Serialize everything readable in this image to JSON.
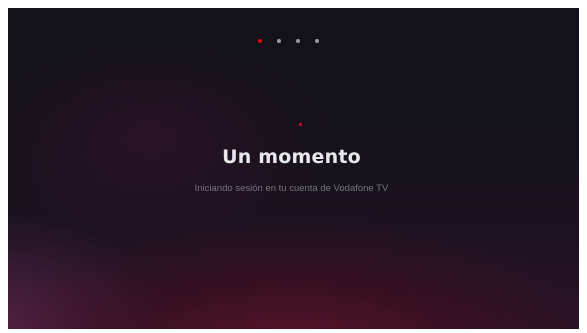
{
  "screen": {
    "title": "Un momento",
    "subtitle": "Iniciando sesión en tu cuenta de Vodafone TV"
  },
  "pager": {
    "total": 4,
    "active_index": 0
  },
  "colors": {
    "accent": "#e60000",
    "title_text": "#e9e8ec",
    "subtitle_text": "#77737d",
    "inactive_dot": "#9b9aa2"
  },
  "icons": {
    "loading": "loading-indicator-icon"
  }
}
